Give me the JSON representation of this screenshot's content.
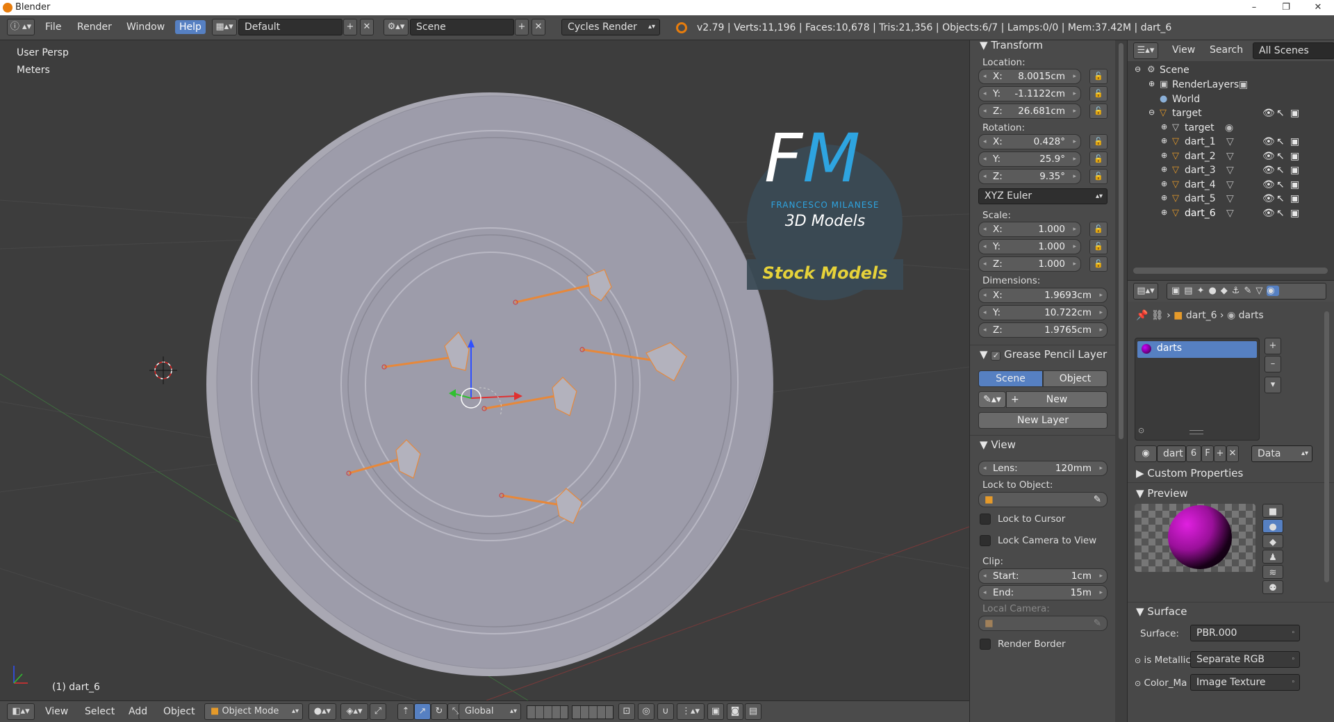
{
  "window": {
    "title": "Blender",
    "minimize": "–",
    "maximize": "❐",
    "close": "✕"
  },
  "topbar": {
    "menus": [
      "File",
      "Render",
      "Window",
      "Help"
    ],
    "screen_layout": "Default",
    "scene": "Scene",
    "render_engine": "Cycles Render",
    "stats": "v2.79 | Verts:11,196 | Faces:10,678 | Tris:21,356 | Objects:6/7 | Lamps:0/0 | Mem:37.42M | dart_6"
  },
  "viewport": {
    "view_name": "User Persp",
    "units": "Meters",
    "active_object": "(1) dart_6",
    "watermark": {
      "line1": "FRANCESCO MILANESE",
      "line2": "3D Models",
      "badge": "Stock Models",
      "logo_text_f": "F",
      "logo_text_m": "M"
    }
  },
  "bottombar": {
    "menus": [
      "View",
      "Select",
      "Add",
      "Object"
    ],
    "mode": "Object Mode",
    "orientation": "Global"
  },
  "transform": {
    "title": "Transform",
    "location_label": "Location:",
    "location": [
      {
        "k": "X:",
        "v": "8.0015cm"
      },
      {
        "k": "Y:",
        "v": "-1.1122cm"
      },
      {
        "k": "Z:",
        "v": "26.681cm"
      }
    ],
    "rotation_label": "Rotation:",
    "rotation": [
      {
        "k": "X:",
        "v": "0.428°"
      },
      {
        "k": "Y:",
        "v": "25.9°"
      },
      {
        "k": "Z:",
        "v": "9.35°"
      }
    ],
    "rotation_mode": "XYZ Euler",
    "scale_label": "Scale:",
    "scale": [
      {
        "k": "X:",
        "v": "1.000"
      },
      {
        "k": "Y:",
        "v": "1.000"
      },
      {
        "k": "Z:",
        "v": "1.000"
      }
    ],
    "dimensions_label": "Dimensions:",
    "dimensions": [
      {
        "k": "X:",
        "v": "1.9693cm"
      },
      {
        "k": "Y:",
        "v": "10.722cm"
      },
      {
        "k": "Z:",
        "v": "1.9765cm"
      }
    ]
  },
  "grease_pencil": {
    "title": "Grease Pencil Layer",
    "tab_scene": "Scene",
    "tab_object": "Object",
    "new_label": "New",
    "new_layer_label": "New Layer"
  },
  "view_panel": {
    "title": "View",
    "lens_label": "Lens:",
    "lens_value": "120mm",
    "lock_object_label": "Lock to Object:",
    "lock_cursor": "Lock to Cursor",
    "lock_camera": "Lock Camera to View",
    "clip_label": "Clip:",
    "clip_start_label": "Start:",
    "clip_start": "1cm",
    "clip_end_label": "End:",
    "clip_end": "15m",
    "local_camera_label": "Local Camera:",
    "render_border": "Render Border"
  },
  "outliner": {
    "menus": [
      "View",
      "Search"
    ],
    "filter": "All Scenes",
    "items": [
      {
        "label": "Scene",
        "indent": 0
      },
      {
        "label": "RenderLayers",
        "indent": 1
      },
      {
        "label": "World",
        "indent": 1
      },
      {
        "label": "target",
        "indent": 1
      },
      {
        "label": "target",
        "indent": 2
      },
      {
        "label": "dart_1",
        "indent": 2
      },
      {
        "label": "dart_2",
        "indent": 2
      },
      {
        "label": "dart_3",
        "indent": 2
      },
      {
        "label": "dart_4",
        "indent": 2
      },
      {
        "label": "dart_5",
        "indent": 2
      },
      {
        "label": "dart_6",
        "indent": 2
      }
    ]
  },
  "material": {
    "breadcrumb_object": "dart_6",
    "breadcrumb_material": "darts",
    "slot_name": "darts",
    "datablock_name": "dart",
    "users": "6",
    "fake_user": "F",
    "link": "Data",
    "custom_properties": "Custom Properties",
    "preview": "Preview",
    "surface_header": "Surface",
    "surface_label": "Surface:",
    "surface_value": "PBR.000",
    "is_metallic_label": "is Metallic",
    "is_metallic_value": "Separate RGB",
    "color_map_label": "Color_Ma",
    "color_map_value": "Image Texture"
  }
}
